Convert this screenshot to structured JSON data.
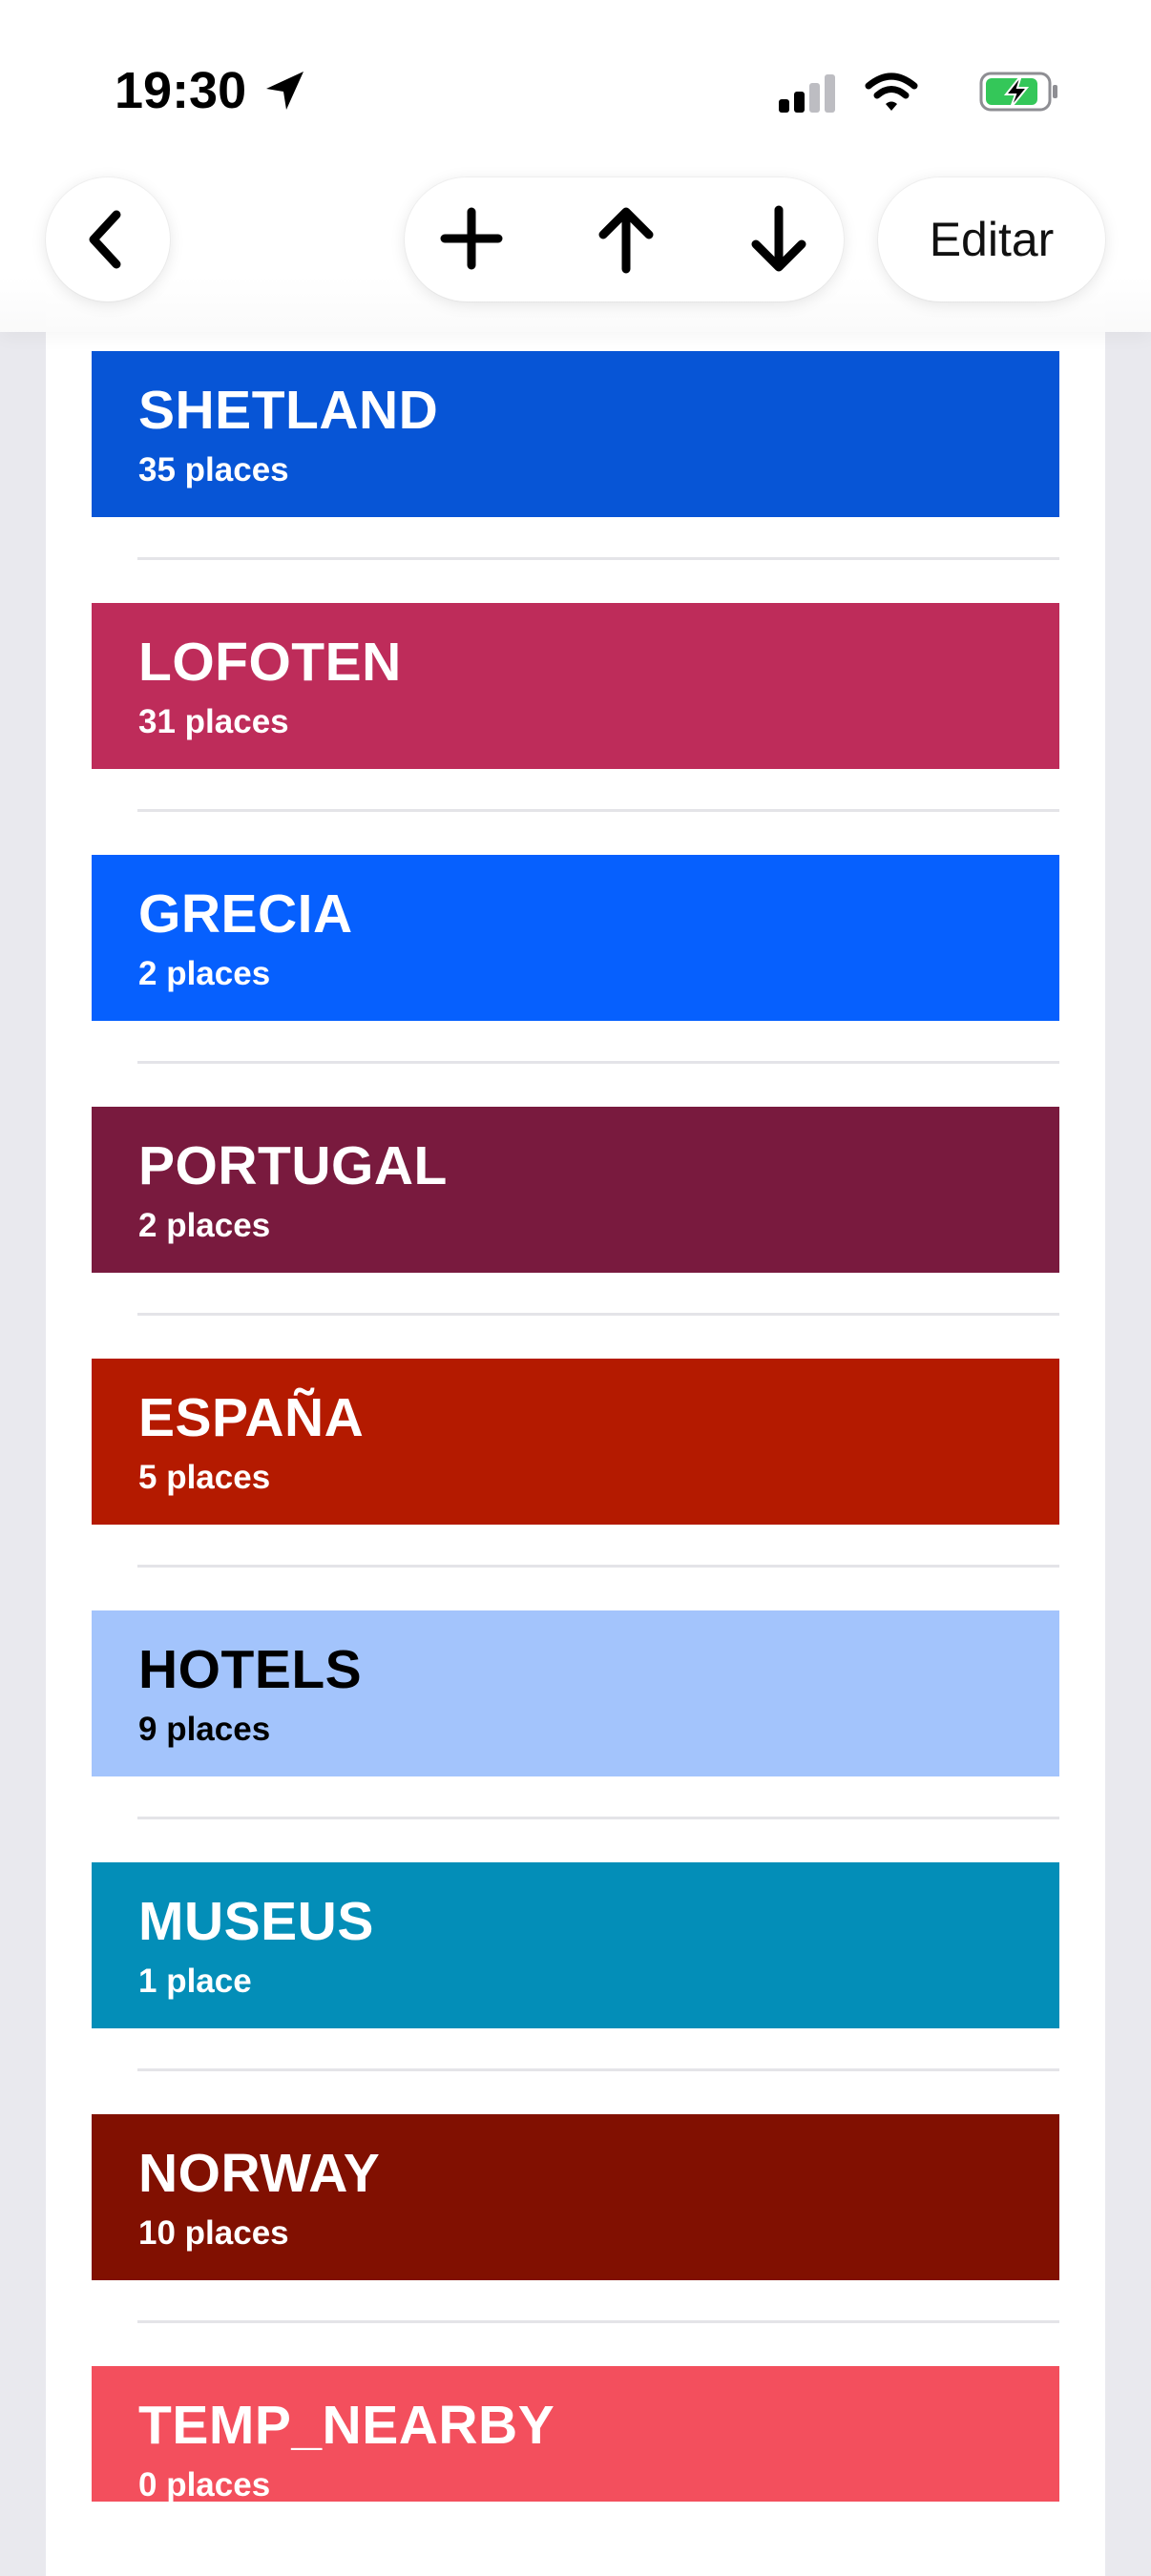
{
  "status_bar": {
    "time": "19:30",
    "icons": [
      "location-arrow-icon",
      "cellular-signal-icon",
      "wifi-icon",
      "battery-charging-icon"
    ]
  },
  "toolbar": {
    "back_icon": "chevron-left-icon",
    "add_icon": "plus-icon",
    "move_up_icon": "arrow-up-icon",
    "move_down_icon": "arrow-down-icon",
    "edit_label": "Editar"
  },
  "lists": [
    {
      "title": "SHETLAND",
      "count": "35 places",
      "color": "#0755D6",
      "text_color": "#FFFFFF"
    },
    {
      "title": "LOFOTEN",
      "count": "31 places",
      "color": "#BE2C5A",
      "text_color": "#FFFFFF"
    },
    {
      "title": "GRECIA",
      "count": "2 places",
      "color": "#0660FE",
      "text_color": "#FFFFFF"
    },
    {
      "title": "PORTUGAL",
      "count": "2 places",
      "color": "#791A3E",
      "text_color": "#FFFFFF"
    },
    {
      "title": "ESPAÑA",
      "count": "5 places",
      "color": "#B41A00",
      "text_color": "#FFFFFF"
    },
    {
      "title": "HOTELS",
      "count": "9 places",
      "color": "#A3C4FC",
      "text_color": "#000000"
    },
    {
      "title": "MUSEUS",
      "count": "1 place",
      "color": "#038EB8",
      "text_color": "#FFFFFF"
    },
    {
      "title": "NORWAY",
      "count": "10 places",
      "color": "#811001",
      "text_color": "#FFFFFF"
    },
    {
      "title": "TEMP_NEARBY",
      "count": "0 places",
      "color": "#F34F5D",
      "text_color": "#FFFFFF"
    }
  ]
}
